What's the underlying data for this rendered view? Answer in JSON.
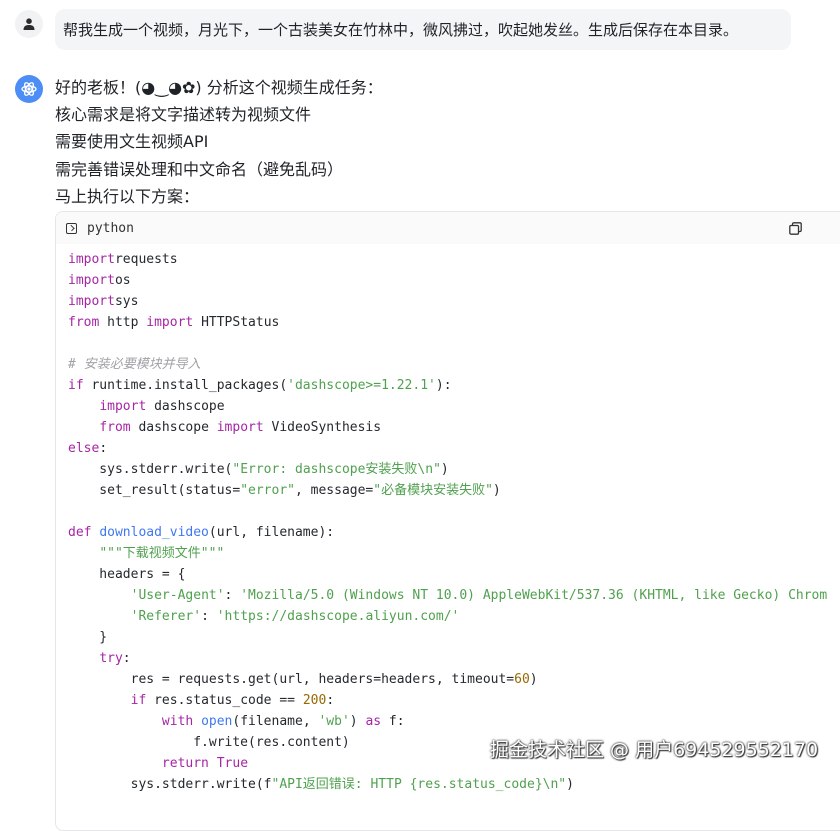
{
  "user_message": {
    "text": "帮我生成一个视频，月光下，一个古装美女在竹林中，微风拂过，吹起她发丝。生成后保存在本目录。"
  },
  "assistant": {
    "lines": [
      "好的老板！(◕‿◕✿) 分析这个视频生成任务：",
      "核心需求是将文字描述转为视频文件",
      "需要使用文生视频API",
      "需完善错误处理和中文命名（避免乱码）",
      "马上执行以下方案："
    ]
  },
  "code_block": {
    "language": "python",
    "lines": [
      [
        [
          "kw",
          "import"
        ],
        [
          "",
          "requests"
        ]
      ],
      [
        [
          "kw",
          "import"
        ],
        [
          "",
          "os"
        ]
      ],
      [
        [
          "kw",
          "import"
        ],
        [
          "",
          "sys"
        ]
      ],
      [
        [
          "kw",
          "from"
        ],
        [
          "",
          " http "
        ],
        [
          "kw",
          "import"
        ],
        [
          "",
          " HTTPStatus"
        ]
      ],
      [],
      [
        [
          "cm",
          "# 安装必要模块并导入"
        ]
      ],
      [
        [
          "kw",
          "if"
        ],
        [
          "",
          " runtime.install_packages("
        ],
        [
          "str",
          "'dashscope>=1.22.1'"
        ],
        [
          "",
          "):"
        ]
      ],
      [
        [
          "",
          "    "
        ],
        [
          "kw",
          "import"
        ],
        [
          "",
          " dashscope"
        ]
      ],
      [
        [
          "",
          "    "
        ],
        [
          "kw",
          "from"
        ],
        [
          "",
          " dashscope "
        ],
        [
          "kw",
          "import"
        ],
        [
          "",
          " VideoSynthesis"
        ]
      ],
      [
        [
          "kw",
          "else"
        ],
        [
          "",
          ":"
        ]
      ],
      [
        [
          "",
          "    sys.stderr.write("
        ],
        [
          "str",
          "\"Error: dashscope安装失败\\n\""
        ],
        [
          "",
          ")"
        ]
      ],
      [
        [
          "",
          "    set_result(status="
        ],
        [
          "str",
          "\"error\""
        ],
        [
          "",
          ", message="
        ],
        [
          "str",
          "\"必备模块安装失败\""
        ],
        [
          "",
          ")"
        ]
      ],
      [],
      [
        [
          "kw",
          "def"
        ],
        [
          "",
          " "
        ],
        [
          "fn",
          "download_video"
        ],
        [
          "",
          "(url, filename):"
        ]
      ],
      [
        [
          "",
          "    "
        ],
        [
          "str",
          "\"\"\"下载视频文件\"\"\""
        ]
      ],
      [
        [
          "",
          "    headers = {"
        ]
      ],
      [
        [
          "",
          "        "
        ],
        [
          "str",
          "'User-Agent'"
        ],
        [
          "",
          ": "
        ],
        [
          "str",
          "'Mozilla/5.0 (Windows NT 10.0) AppleWebKit/537.36 (KHTML, like Gecko) Chrom"
        ]
      ],
      [
        [
          "",
          "        "
        ],
        [
          "str",
          "'Referer'"
        ],
        [
          "",
          ": "
        ],
        [
          "str",
          "'https://dashscope.aliyun.com/'"
        ]
      ],
      [
        [
          "",
          "    }"
        ]
      ],
      [
        [
          "",
          "    "
        ],
        [
          "kw",
          "try"
        ],
        [
          "",
          ":"
        ]
      ],
      [
        [
          "",
          "        res = requests.get(url, headers=headers, timeout="
        ],
        [
          "num",
          "60"
        ],
        [
          "",
          ")"
        ]
      ],
      [
        [
          "",
          "        "
        ],
        [
          "kw",
          "if"
        ],
        [
          "",
          " res.status_code == "
        ],
        [
          "num",
          "200"
        ],
        [
          "",
          ":"
        ]
      ],
      [
        [
          "",
          "            "
        ],
        [
          "kw",
          "with"
        ],
        [
          "",
          " "
        ],
        [
          "fn",
          "open"
        ],
        [
          "",
          "(filename, "
        ],
        [
          "str",
          "'wb'"
        ],
        [
          "",
          ") "
        ],
        [
          "kw",
          "as"
        ],
        [
          "",
          " f:"
        ]
      ],
      [
        [
          "",
          "                f.write(res.content)"
        ]
      ],
      [
        [
          "",
          "            "
        ],
        [
          "kw",
          "return"
        ],
        [
          "",
          " "
        ],
        [
          "kw",
          "True"
        ]
      ],
      [
        [
          "",
          "        sys.stderr.write(f"
        ],
        [
          "str",
          "\"API返回错误: HTTP {res.status_code}\\n\""
        ],
        [
          "",
          ")"
        ]
      ]
    ]
  },
  "watermark": {
    "text": "掘金技术社区 @ 用户694529552170"
  },
  "colors": {
    "bot_avatar": "#4c8df6",
    "bubble_bg": "#f4f5f7",
    "keyword": "#a626a4",
    "string": "#50a14f",
    "function": "#4078f2",
    "comment": "#a0a1a7"
  }
}
